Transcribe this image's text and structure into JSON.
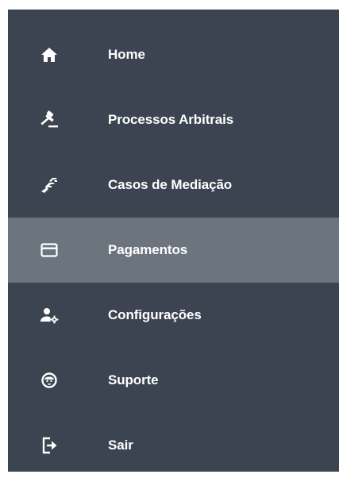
{
  "sidebar": {
    "background": "#3b4450",
    "active_background": "#6c747d",
    "text_color": "#ffffff",
    "items": [
      {
        "label": "Home",
        "icon": "home-icon"
      },
      {
        "label": "Processos Arbitrais",
        "icon": "gavel-icon"
      },
      {
        "label": "Casos de Mediação",
        "icon": "handshake-icon"
      },
      {
        "label": "Pagamentos",
        "icon": "credit-card-icon",
        "active": true
      },
      {
        "label": "Configurações",
        "icon": "user-settings-icon"
      },
      {
        "label": "Suporte",
        "icon": "support-agent-icon"
      },
      {
        "label": "Sair",
        "icon": "logout-icon"
      }
    ]
  }
}
